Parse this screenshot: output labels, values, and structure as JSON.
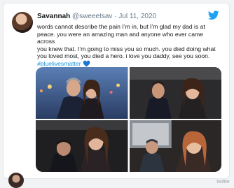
{
  "tweet": {
    "display_name": "Savannah",
    "handle": "@sweeetsav",
    "separator": "·",
    "date": "Jul 11, 2020",
    "text_lines": [
      "words cannot describe the pain I’m in, but I’m glad my dad is at",
      "peace. you were an amazing man and anyone who ever came across",
      "you knew that. I’m going to miss you so much. you died doing what",
      "you loved most, you died a hero. i love you daddy, see you soon."
    ],
    "hashtag": "#bluelivesmatter",
    "emoji": "💙"
  },
  "credit": "twitter",
  "colors": {
    "twitter_blue": "#1da1f2",
    "link_blue": "#1b95e0",
    "text": "#14171a",
    "muted": "#657786"
  },
  "icons": {
    "bird": "twitter-bird-icon"
  }
}
